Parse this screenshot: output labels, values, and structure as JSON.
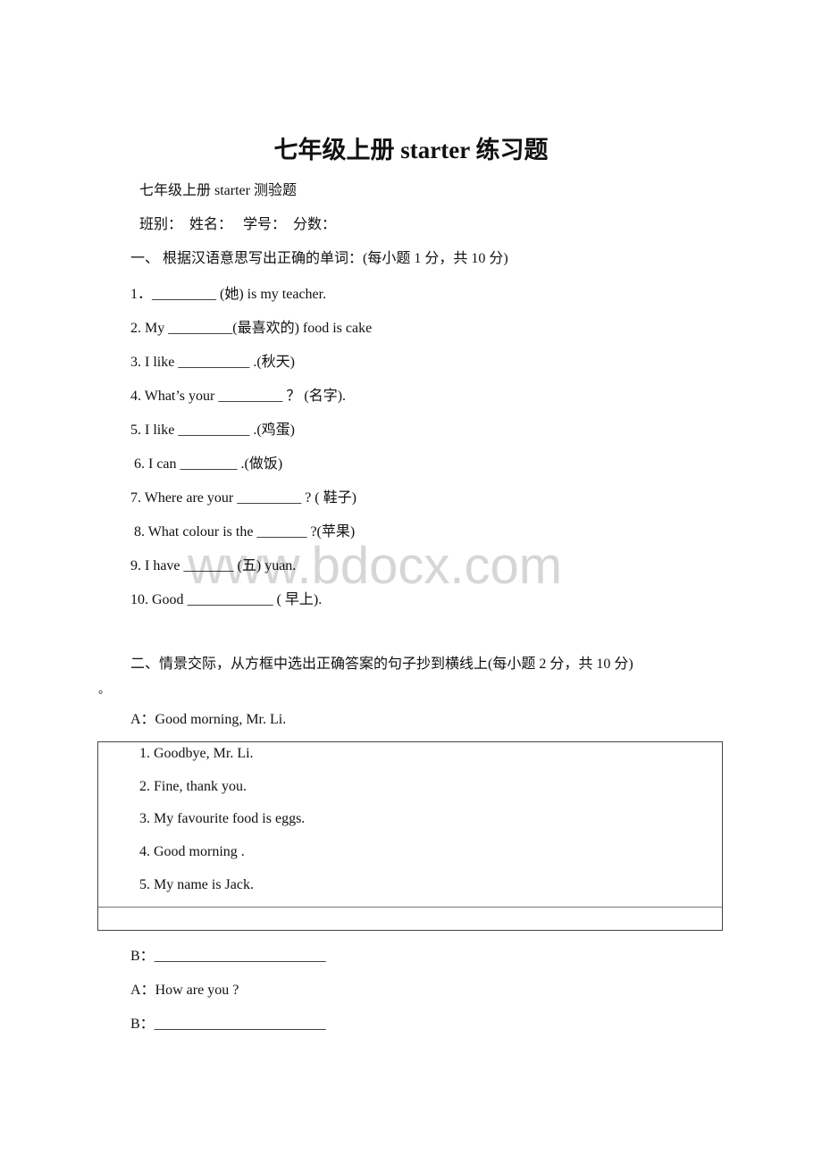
{
  "document": {
    "title": "七年级上册 starter 练习题",
    "subtitle": "七年级上册 starter 测验题",
    "info_line": "班别：  姓名：   学号：  分数：",
    "watermark": "www.bdocx.com"
  },
  "section1": {
    "heading": "一、 根据汉语意思写出正确的单词：(每小题 1 分，共 10 分)",
    "questions": [
      {
        "prefix": "1．",
        "blank": "_________",
        "suffix": " (她) is my teacher."
      },
      {
        "prefix": "2. My ",
        "blank": "_________",
        "suffix": "(最喜欢的) food is cake"
      },
      {
        "prefix": "3. I like ",
        "blank": "__________",
        "suffix": " .(秋天)"
      },
      {
        "prefix": "4. What’s your ",
        "blank": "_________",
        "suffix": " ？ (名字)."
      },
      {
        "prefix": "5. I like ",
        "blank": "__________",
        "suffix": " .(鸡蛋)"
      },
      {
        "prefix": " 6. I can ",
        "blank": "________",
        "suffix": " .(做饭)"
      },
      {
        "prefix": "7. Where are your ",
        "blank": "_________",
        "suffix": " ? ( 鞋子)"
      },
      {
        "prefix": " 8. What colour is the ",
        "blank": "_______",
        "suffix": " ?(苹果)"
      },
      {
        "prefix": "9. I have ",
        "blank": "_______",
        "suffix": " (五) yuan."
      },
      {
        "prefix": "10. Good ",
        "blank": "____________",
        "suffix": " ( 早上)."
      }
    ]
  },
  "section2": {
    "heading": "二、情景交际，从方框中选出正确答案的句子抄到横线上(每小题 2 分，共 10 分)",
    "heading_tail": "。",
    "dialog_start": "A：Good morning, Mr. Li.",
    "options": [
      "1. Goodbye, Mr. Li.",
      "2. Fine, thank you.",
      "3. My favourite food is eggs.",
      "4. Good morning .",
      "5. My name is Jack."
    ],
    "dialog": [
      {
        "speaker": "B：",
        "text": "",
        "answer_blank": "________________________"
      },
      {
        "speaker": "A：",
        "text": "How are you ?",
        "answer_blank": ""
      },
      {
        "speaker": "B：",
        "text": "",
        "answer_blank": "________________________"
      }
    ]
  }
}
